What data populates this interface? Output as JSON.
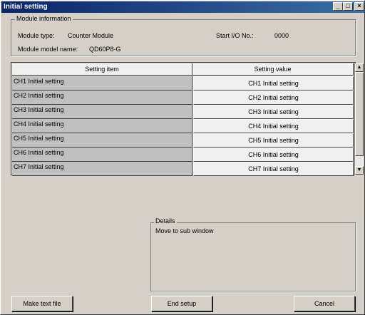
{
  "window": {
    "title": "Initial setting",
    "minimize_glyph": "_",
    "maximize_glyph": "□",
    "close_glyph": "×"
  },
  "module_info": {
    "group_label": "Module information",
    "type_label": "Module type:",
    "type_value": "Counter Module",
    "model_label": "Module model name:",
    "model_value": "QD60P8-G",
    "start_io_label": "Start I/O No.:",
    "start_io_value": "0000"
  },
  "grid": {
    "col_item": "Setting item",
    "col_value": "Setting value",
    "rows": [
      {
        "item": "CH1 Initial setting",
        "value": "CH1 Initial setting"
      },
      {
        "item": "CH2 Initial setting",
        "value": "CH2 Initial setting"
      },
      {
        "item": "CH3 Initial setting",
        "value": "CH3 Initial setting"
      },
      {
        "item": "CH4 Initial setting",
        "value": "CH4 Initial setting"
      },
      {
        "item": "CH5 Initial setting",
        "value": "CH5 Initial setting"
      },
      {
        "item": "CH6 Initial setting",
        "value": "CH6 Initial setting"
      },
      {
        "item": "CH7 Initial setting",
        "value": "CH7 Initial setting"
      }
    ],
    "scroll_up_glyph": "▲",
    "scroll_down_glyph": "▼"
  },
  "details": {
    "group_label": "Details",
    "text": "Move to sub window"
  },
  "buttons": {
    "make_text_file": "Make text file",
    "end_setup": "End setup",
    "cancel": "Cancel"
  },
  "colors": {
    "titlebar": "#0a246a",
    "face": "#d4d0c8"
  }
}
